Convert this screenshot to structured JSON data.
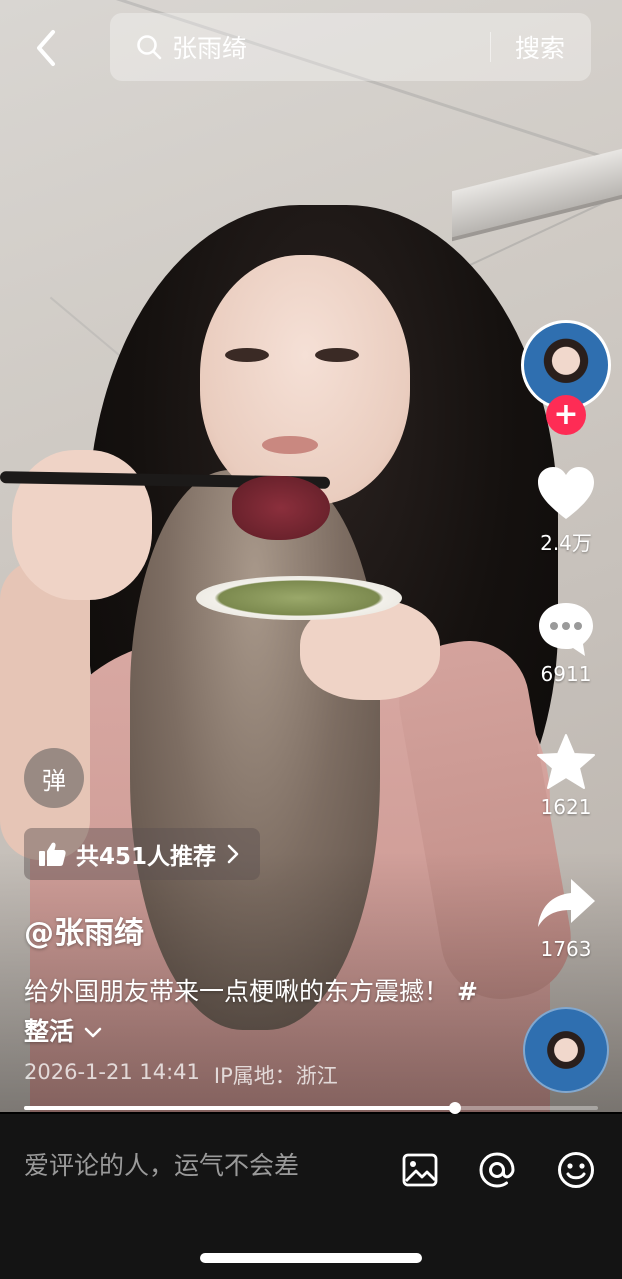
{
  "search": {
    "query": "张雨绮",
    "button_label": "搜索"
  },
  "rail": {
    "likes": "2.4万",
    "comments": "6911",
    "favorites": "1621",
    "shares": "1763",
    "follow_symbol": "+"
  },
  "overlay": {
    "danmu_label": "弹",
    "recommend_text": "共451人推荐",
    "author": "@张雨绮",
    "caption": "给外国朋友带来一点梗啾的东方震撼！",
    "hashtag": "#整活",
    "date": "2026-1-21 14:41",
    "ip": "IP属地：浙江"
  },
  "progress": {
    "played_fraction": 0.75
  },
  "bottom": {
    "comment_placeholder": "爱评论的人，运气不会差"
  },
  "icons": [
    "back-arrow-icon",
    "search-icon",
    "heart-icon",
    "comment-icon",
    "star-icon",
    "share-icon",
    "thumbs-up-icon",
    "chevron-right-icon",
    "chevron-down-icon",
    "image-icon",
    "at-icon",
    "emoji-icon"
  ],
  "colors": {
    "accent": "#fe2c55",
    "bottom_bar": "#141414"
  }
}
